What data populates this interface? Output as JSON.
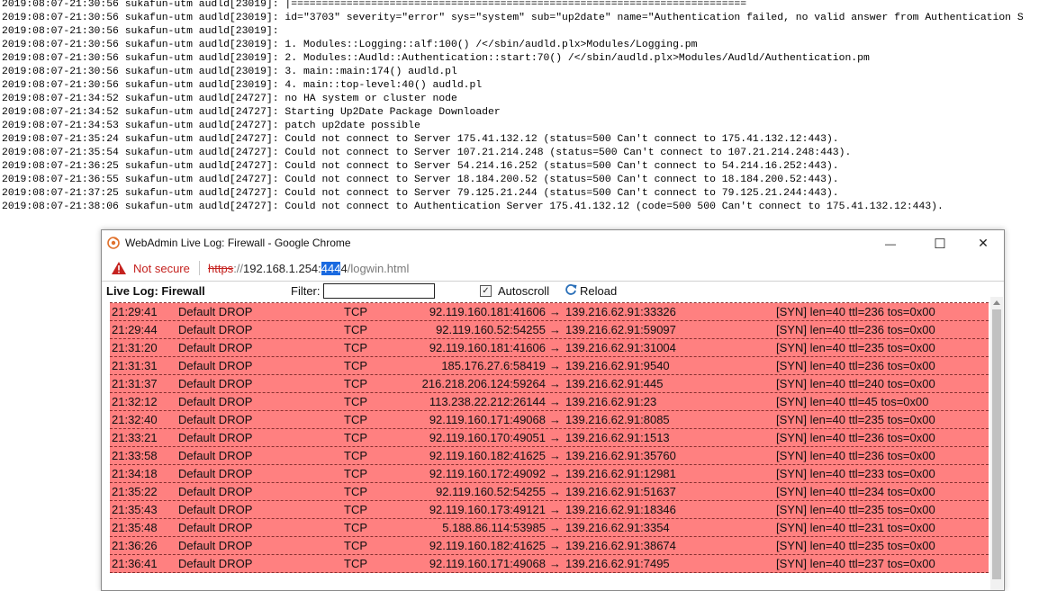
{
  "background_log": [
    "2019:08:07-21:30:56 sukafun-utm audld[23019]: |==========================================================================",
    "2019:08:07-21:30:56 sukafun-utm audld[23019]: id=\"3703\" severity=\"error\" sys=\"system\" sub=\"up2date\" name=\"Authentication failed, no valid answer from Authentication S",
    "2019:08:07-21:30:56 sukafun-utm audld[23019]:",
    "2019:08:07-21:30:56 sukafun-utm audld[23019]: 1. Modules::Logging::alf:100() /</sbin/audld.plx>Modules/Logging.pm",
    "2019:08:07-21:30:56 sukafun-utm audld[23019]: 2. Modules::Audld::Authentication::start:70() /</sbin/audld.plx>Modules/Audld/Authentication.pm",
    "2019:08:07-21:30:56 sukafun-utm audld[23019]: 3. main::main:174() audld.pl",
    "2019:08:07-21:30:56 sukafun-utm audld[23019]: 4. main::top-level:40() audld.pl",
    "2019:08:07-21:34:52 sukafun-utm audld[24727]: no HA system or cluster node",
    "2019:08:07-21:34:52 sukafun-utm audld[24727]: Starting Up2Date Package Downloader",
    "2019:08:07-21:34:53 sukafun-utm audld[24727]: patch up2date possible",
    "2019:08:07-21:35:24 sukafun-utm audld[24727]: Could not connect to Server 175.41.132.12 (status=500 Can't connect to 175.41.132.12:443).",
    "2019:08:07-21:35:54 sukafun-utm audld[24727]: Could not connect to Server 107.21.214.248 (status=500 Can't connect to 107.21.214.248:443).",
    "2019:08:07-21:36:25 sukafun-utm audld[24727]: Could not connect to Server 54.214.16.252 (status=500 Can't connect to 54.214.16.252:443).",
    "2019:08:07-21:36:55 sukafun-utm audld[24727]: Could not connect to Server 18.184.200.52 (status=500 Can't connect to 18.184.200.52:443).",
    "2019:08:07-21:37:25 sukafun-utm audld[24727]: Could not connect to Server 79.125.21.244 (status=500 Can't connect to 79.125.21.244:443).",
    "2019:08:07-21:38:06 sukafun-utm audld[24727]: Could not connect to Authentication Server 175.41.132.12 (code=500 500 Can't connect to 175.41.132.12:443)."
  ],
  "window": {
    "title": "WebAdmin Live Log: Firewall - Google Chrome",
    "minimize_glyph": "—",
    "maximize_glyph": "☐",
    "close_glyph": "✕"
  },
  "address_bar": {
    "security_label": "Not secure",
    "url_scheme": "https",
    "url_sep": "://",
    "url_host": "192.168.1.254:",
    "url_port_selected": "444",
    "url_port_rest": "4",
    "url_path": "/logwin.html"
  },
  "toolbar": {
    "heading": "Live Log: Firewall",
    "filter_label": "Filter:",
    "filter_value": "",
    "autoscroll_label": "Autoscroll",
    "autoscroll_checked": true,
    "reload_label": "Reload"
  },
  "colors": {
    "row_background": "#ff8080",
    "not_secure": "#c5221f"
  },
  "log_rows": [
    {
      "time": "21:29:41",
      "action": "Default DROP",
      "proto": "TCP",
      "src": "92.119.160.181:41606",
      "arrow": "→",
      "dst": "139.216.62.91:33326",
      "flags": "[SYN]  len=40  ttl=236  tos=0x00"
    },
    {
      "time": "21:29:44",
      "action": "Default DROP",
      "proto": "TCP",
      "src": "92.119.160.52:54255",
      "arrow": "→",
      "dst": "139.216.62.91:59097",
      "flags": "[SYN]  len=40  ttl=236  tos=0x00"
    },
    {
      "time": "21:31:20",
      "action": "Default DROP",
      "proto": "TCP",
      "src": "92.119.160.181:41606",
      "arrow": "→",
      "dst": "139.216.62.91:31004",
      "flags": "[SYN]  len=40  ttl=235  tos=0x00"
    },
    {
      "time": "21:31:31",
      "action": "Default DROP",
      "proto": "TCP",
      "src": "185.176.27.6:58419",
      "arrow": "→",
      "dst": "139.216.62.91:9540",
      "flags": "[SYN]  len=40  ttl=236  tos=0x00"
    },
    {
      "time": "21:31:37",
      "action": "Default DROP",
      "proto": "TCP",
      "src": "216.218.206.124:59264",
      "arrow": "→",
      "dst": "139.216.62.91:445",
      "flags": "[SYN]  len=40  ttl=240  tos=0x00"
    },
    {
      "time": "21:32:12",
      "action": "Default DROP",
      "proto": "TCP",
      "src": "113.238.22.212:26144",
      "arrow": "→",
      "dst": "139.216.62.91:23",
      "flags": "[SYN]  len=40  ttl=45  tos=0x00"
    },
    {
      "time": "21:32:40",
      "action": "Default DROP",
      "proto": "TCP",
      "src": "92.119.160.171:49068",
      "arrow": "→",
      "dst": "139.216.62.91:8085",
      "flags": "[SYN]  len=40  ttl=235  tos=0x00"
    },
    {
      "time": "21:33:21",
      "action": "Default DROP",
      "proto": "TCP",
      "src": "92.119.160.170:49051",
      "arrow": "→",
      "dst": "139.216.62.91:1513",
      "flags": "[SYN]  len=40  ttl=236  tos=0x00"
    },
    {
      "time": "21:33:58",
      "action": "Default DROP",
      "proto": "TCP",
      "src": "92.119.160.182:41625",
      "arrow": "→",
      "dst": "139.216.62.91:35760",
      "flags": "[SYN]  len=40  ttl=236  tos=0x00"
    },
    {
      "time": "21:34:18",
      "action": "Default DROP",
      "proto": "TCP",
      "src": "92.119.160.172:49092",
      "arrow": "→",
      "dst": "139.216.62.91:12981",
      "flags": "[SYN]  len=40  ttl=233  tos=0x00"
    },
    {
      "time": "21:35:22",
      "action": "Default DROP",
      "proto": "TCP",
      "src": "92.119.160.52:54255",
      "arrow": "→",
      "dst": "139.216.62.91:51637",
      "flags": "[SYN]  len=40  ttl=234  tos=0x00"
    },
    {
      "time": "21:35:43",
      "action": "Default DROP",
      "proto": "TCP",
      "src": "92.119.160.173:49121",
      "arrow": "→",
      "dst": "139.216.62.91:18346",
      "flags": "[SYN]  len=40  ttl=235  tos=0x00"
    },
    {
      "time": "21:35:48",
      "action": "Default DROP",
      "proto": "TCP",
      "src": "5.188.86.114:53985",
      "arrow": "→",
      "dst": "139.216.62.91:3354",
      "flags": "[SYN]  len=40  ttl=231  tos=0x00"
    },
    {
      "time": "21:36:26",
      "action": "Default DROP",
      "proto": "TCP",
      "src": "92.119.160.182:41625",
      "arrow": "→",
      "dst": "139.216.62.91:38674",
      "flags": "[SYN]  len=40  ttl=235  tos=0x00"
    },
    {
      "time": "21:36:41",
      "action": "Default DROP",
      "proto": "TCP",
      "src": "92.119.160.171:49068",
      "arrow": "→",
      "dst": "139.216.62.91:7495",
      "flags": "[SYN]  len=40  ttl=237  tos=0x00"
    }
  ]
}
